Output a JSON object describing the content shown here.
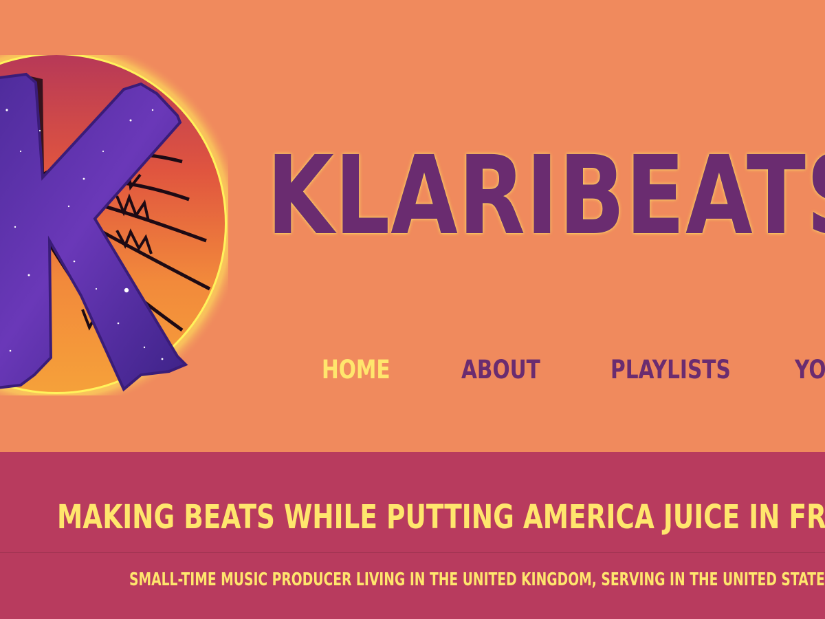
{
  "site": {
    "title": "KLARIBEATS",
    "logo_letter": "K"
  },
  "nav": {
    "items": [
      {
        "label": "HOME",
        "active": true
      },
      {
        "label": "ABOUT",
        "active": false
      },
      {
        "label": "PLAYLISTS",
        "active": false
      },
      {
        "label": "YOU",
        "active": false
      }
    ]
  },
  "hero": {
    "headline": "MAKING BEATS WHILE PUTTING AMERICA JUICE IN FREEDOM P",
    "tagline": "SMALL-TIME MUSIC PRODUCER LIVING IN THE UNITED KINGDOM, SERVING IN THE UNITED STATES AIRFORC"
  },
  "colors": {
    "header_background": "#F08A5D",
    "band_background": "#B83B5E",
    "brand_purple": "#6A2C70",
    "accent_yellow": "#FFE66D"
  }
}
